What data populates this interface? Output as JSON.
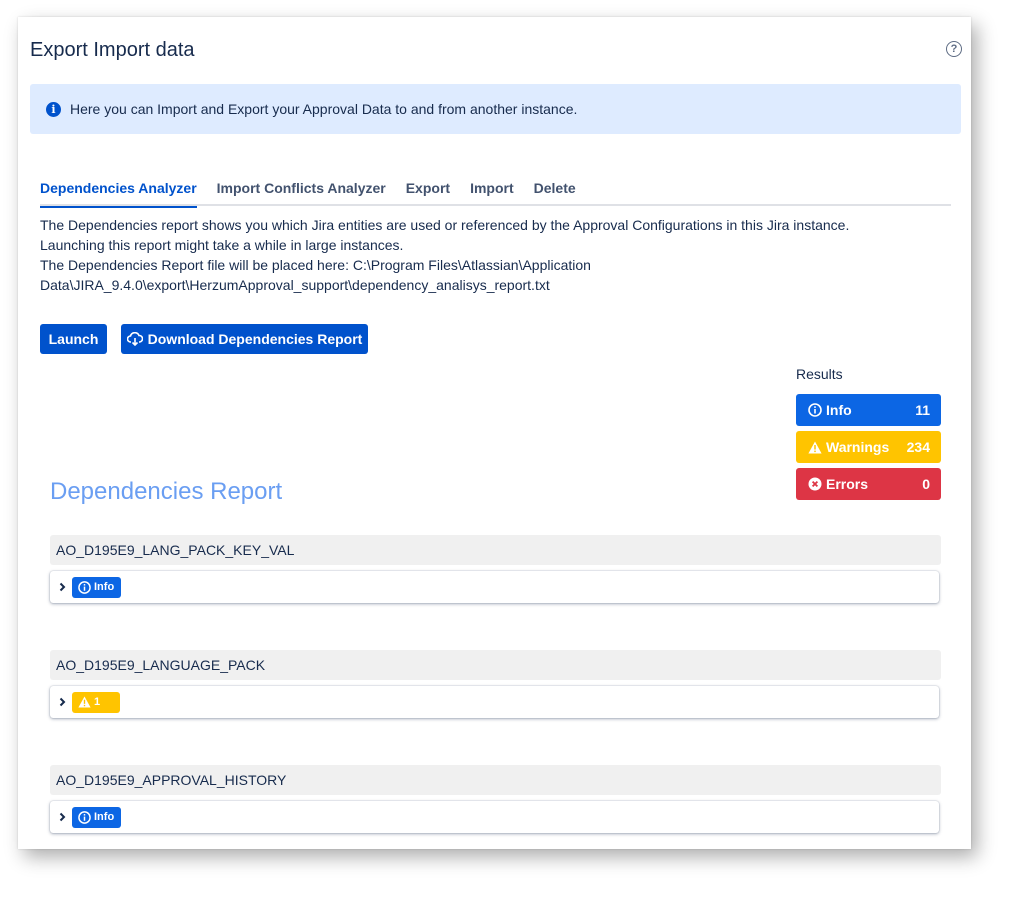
{
  "page": {
    "title": "Export Import data",
    "help_icon": "question-circle-icon"
  },
  "banner": {
    "icon": "info-icon",
    "text": "Here you can Import and Export your Approval Data to and from another instance."
  },
  "tabs": [
    {
      "label": "Dependencies Analyzer",
      "active": true
    },
    {
      "label": "Import Conflicts Analyzer",
      "active": false
    },
    {
      "label": "Export",
      "active": false
    },
    {
      "label": "Import",
      "active": false
    },
    {
      "label": "Delete",
      "active": false
    }
  ],
  "description": {
    "line1": "The Dependencies report shows you which Jira entities are used or referenced by the Approval Configurations in this Jira instance.",
    "line2": "Launching this report might take a while in large instances.",
    "line3": "The Dependencies Report file will be placed here: C:\\Program Files\\Atlassian\\Application",
    "line4": "Data\\JIRA_9.4.0\\export\\HerzumApproval_support\\dependency_analisys_report.txt"
  },
  "buttons": {
    "launch": "Launch",
    "download": "Download Dependencies Report",
    "download_icon": "cloud-download-icon"
  },
  "results": {
    "label": "Results",
    "info": {
      "label": "Info",
      "count": "11",
      "color": "#0c66e4"
    },
    "warnings": {
      "label": "Warnings",
      "count": "234",
      "color": "#ffc400"
    },
    "errors": {
      "label": "Errors",
      "count": "0",
      "color": "#dd3545"
    }
  },
  "report": {
    "title": "Dependencies Report",
    "sections": [
      {
        "name": "AO_D195E9_LANG_PACK_KEY_VAL",
        "badge_type": "info",
        "badge_text": "Info"
      },
      {
        "name": "AO_D195E9_LANGUAGE_PACK",
        "badge_type": "warning",
        "badge_text": "1"
      },
      {
        "name": "AO_D195E9_APPROVAL_HISTORY",
        "badge_type": "info",
        "badge_text": "Info"
      }
    ]
  }
}
